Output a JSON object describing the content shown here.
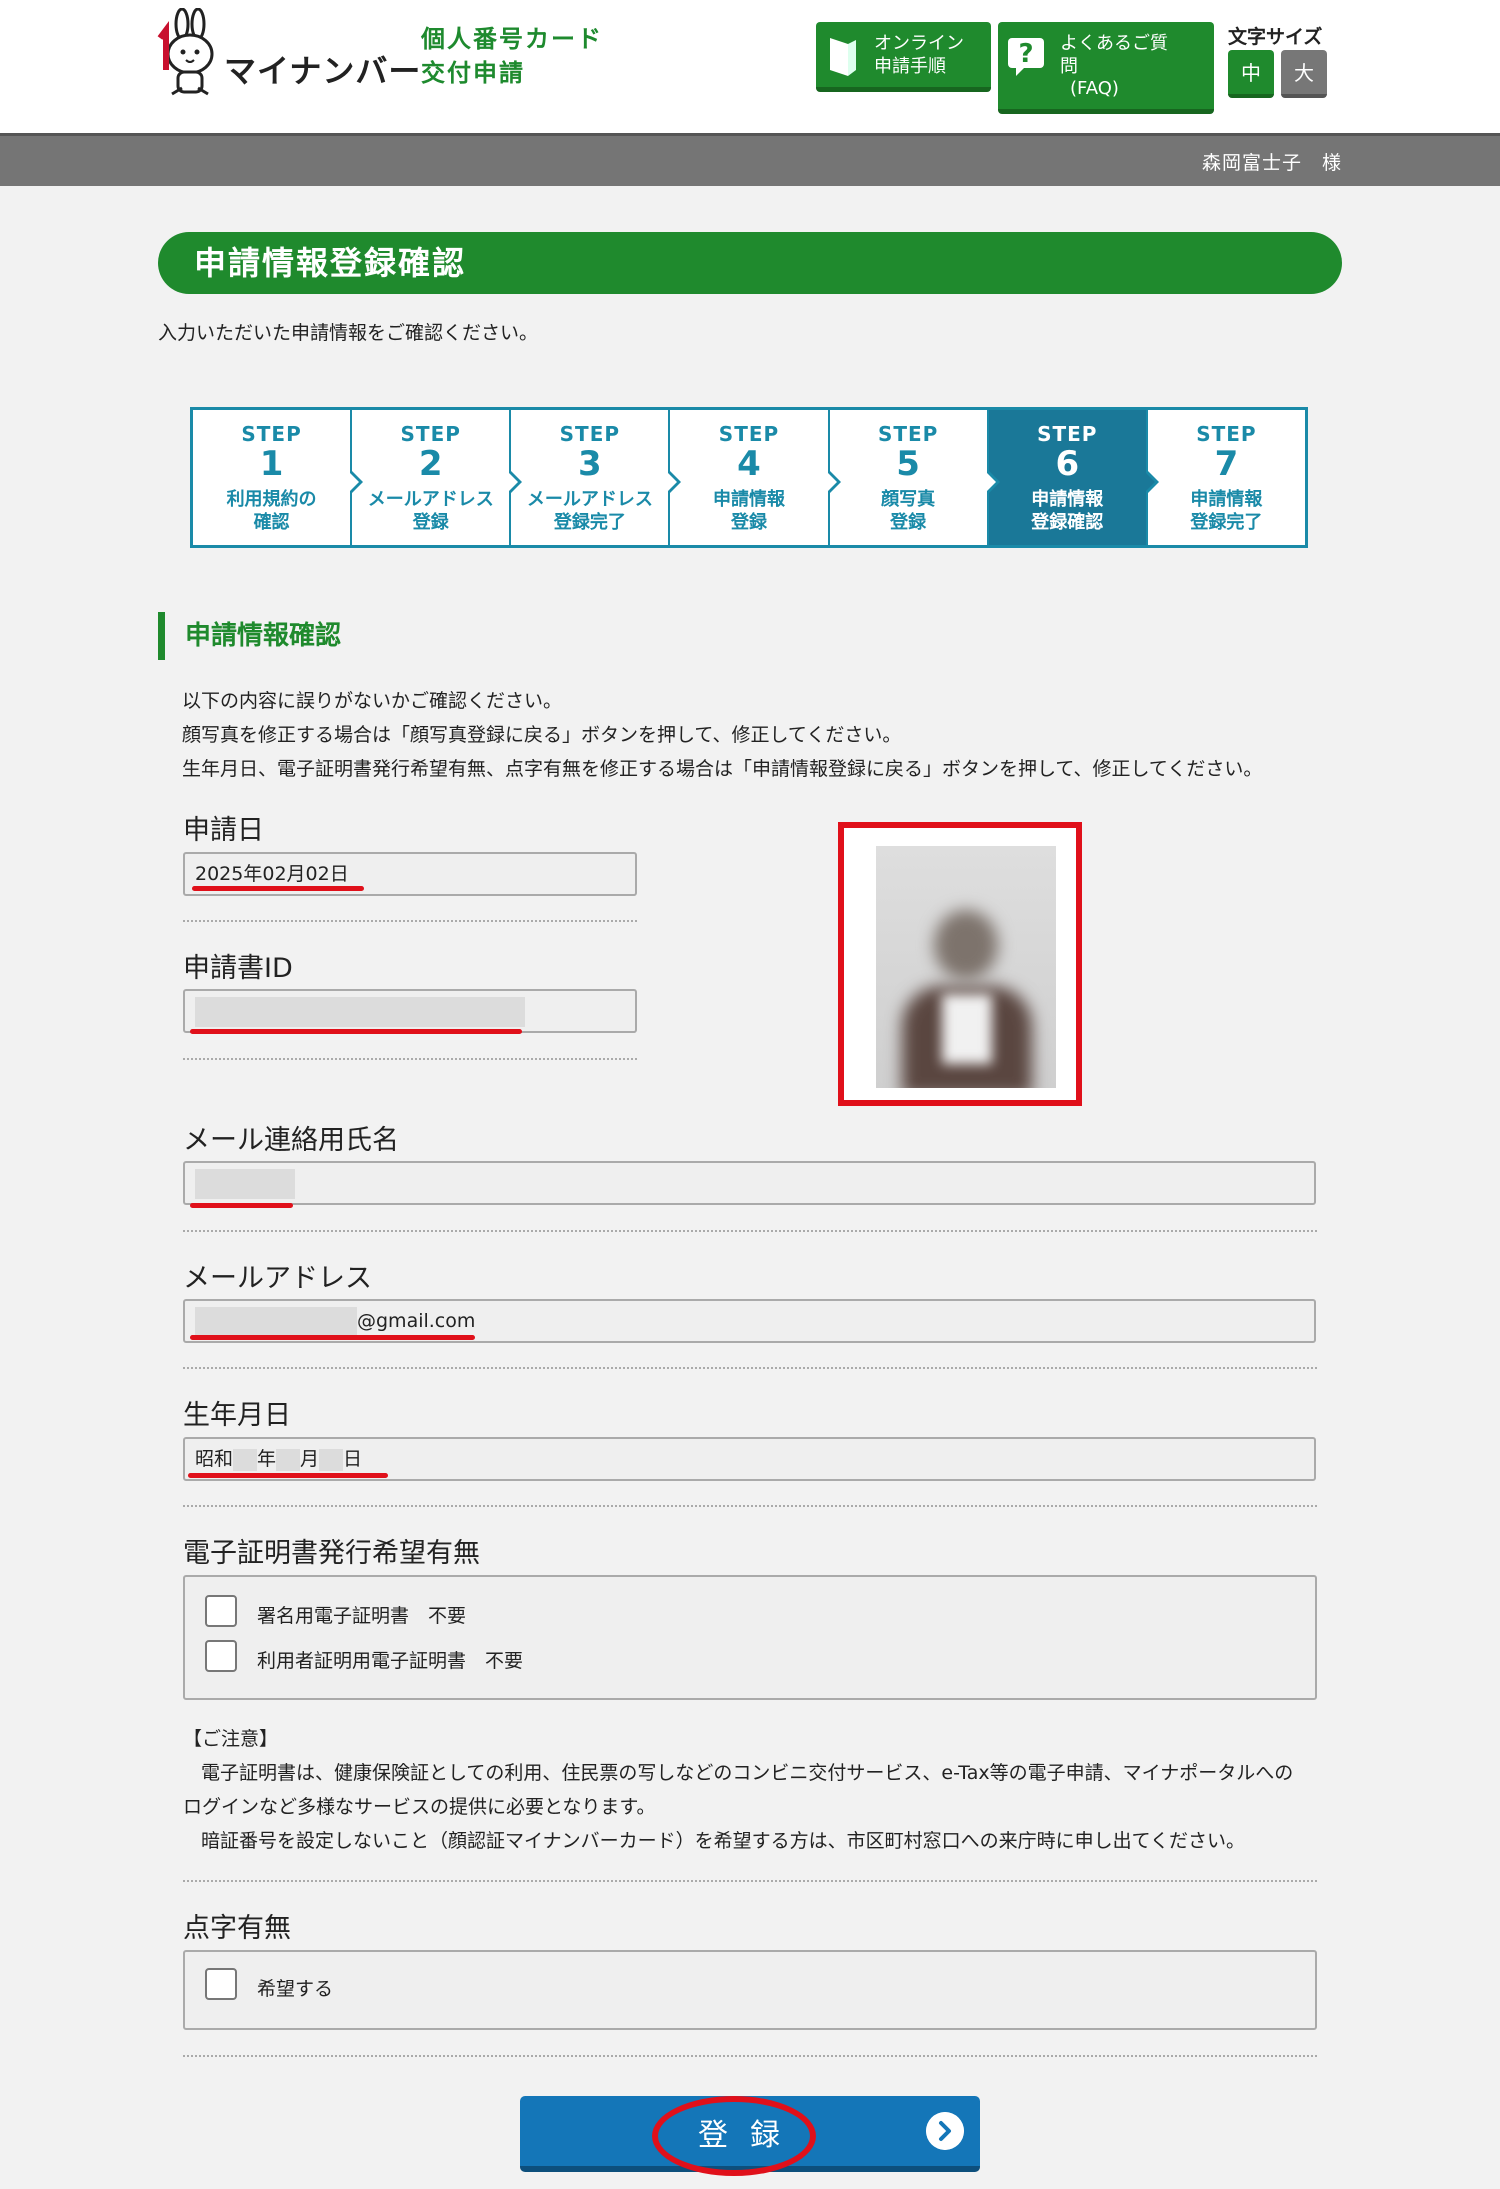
{
  "header": {
    "logo_text": "マイナンバー",
    "service_title_line1": "個人番号カード",
    "service_title_line2": "交付申請",
    "guide_btn_line1": "オンライン",
    "guide_btn_line2": "申請手順",
    "faq_btn_line1": "よくあるご質",
    "faq_btn_line2": "問",
    "faq_btn_sub": "(FAQ)",
    "font_size_label": "文字サイズ",
    "font_size_mid": "中",
    "font_size_large": "大"
  },
  "user_bar": {
    "user_name": "森岡富士子　様"
  },
  "page": {
    "title": "申請情報登録確認",
    "lead": "入力いただいた申請情報をご確認ください。"
  },
  "steps": [
    {
      "label": "STEP",
      "num": "1",
      "line1": "利用規約の",
      "line2": "確認",
      "state": "past"
    },
    {
      "label": "STEP",
      "num": "2",
      "line1": "メールアドレス",
      "line2": "登録",
      "state": "past"
    },
    {
      "label": "STEP",
      "num": "3",
      "line1": "メールアドレス",
      "line2": "登録完了",
      "state": "past"
    },
    {
      "label": "STEP",
      "num": "4",
      "line1": "申請情報",
      "line2": "登録",
      "state": "past"
    },
    {
      "label": "STEP",
      "num": "5",
      "line1": "顔写真",
      "line2": "登録",
      "state": "past"
    },
    {
      "label": "STEP",
      "num": "6",
      "line1": "申請情報",
      "line2": "登録確認",
      "state": "active"
    },
    {
      "label": "STEP",
      "num": "7",
      "line1": "申請情報",
      "line2": "登録完了",
      "state": "future"
    }
  ],
  "section": {
    "heading": "申請情報確認",
    "notes": [
      "以下の内容に誤りがないかご確認ください。",
      "顔写真を修正する場合は「顔写真登録に戻る」ボタンを押して、修正してください。",
      "生年月日、電子証明書発行希望有無、点字有無を修正する場合は「申請情報登録に戻る」ボタンを押して、修正してください。"
    ]
  },
  "fields": {
    "application_date": {
      "label": "申請日",
      "value": "2025年02月02日"
    },
    "application_id": {
      "label": "申請書ID",
      "value": ""
    },
    "mail_name": {
      "label": "メール連絡用氏名",
      "value": ""
    },
    "email": {
      "label": "メールアドレス",
      "value": "@gmail.com"
    },
    "birthdate": {
      "label": "生年月日",
      "era": "昭和",
      "year_unit": "年",
      "month_unit": "月",
      "day_unit": "日"
    }
  },
  "certificate": {
    "label": "電子証明書発行希望有無",
    "options": [
      {
        "text": "署名用電子証明書　不要",
        "checked": false
      },
      {
        "text": "利用者証明用電子証明書　不要",
        "checked": false
      }
    ],
    "caution_title": "【ご注意】",
    "caution_lines": [
      "電子証明書は、健康保険証としての利用、住民票の写しなどのコンビニ交付サービス、e-Tax等の電子申請、マイナポータルへの",
      "ログインなど多様なサービスの提供に必要となります。",
      "暗証番号を設定しないこと（顔認証マイナンバーカード）を希望する方は、市区町村窓口への来庁時に申し出てください。"
    ]
  },
  "braille": {
    "label": "点字有無",
    "option": "希望する",
    "checked": false
  },
  "submit": {
    "label": "登録"
  },
  "colors": {
    "brand_green": "#1f8a2d",
    "step_blue": "#1a8aa8",
    "submit_blue": "#1476b8",
    "highlight_red": "#e0101a"
  }
}
